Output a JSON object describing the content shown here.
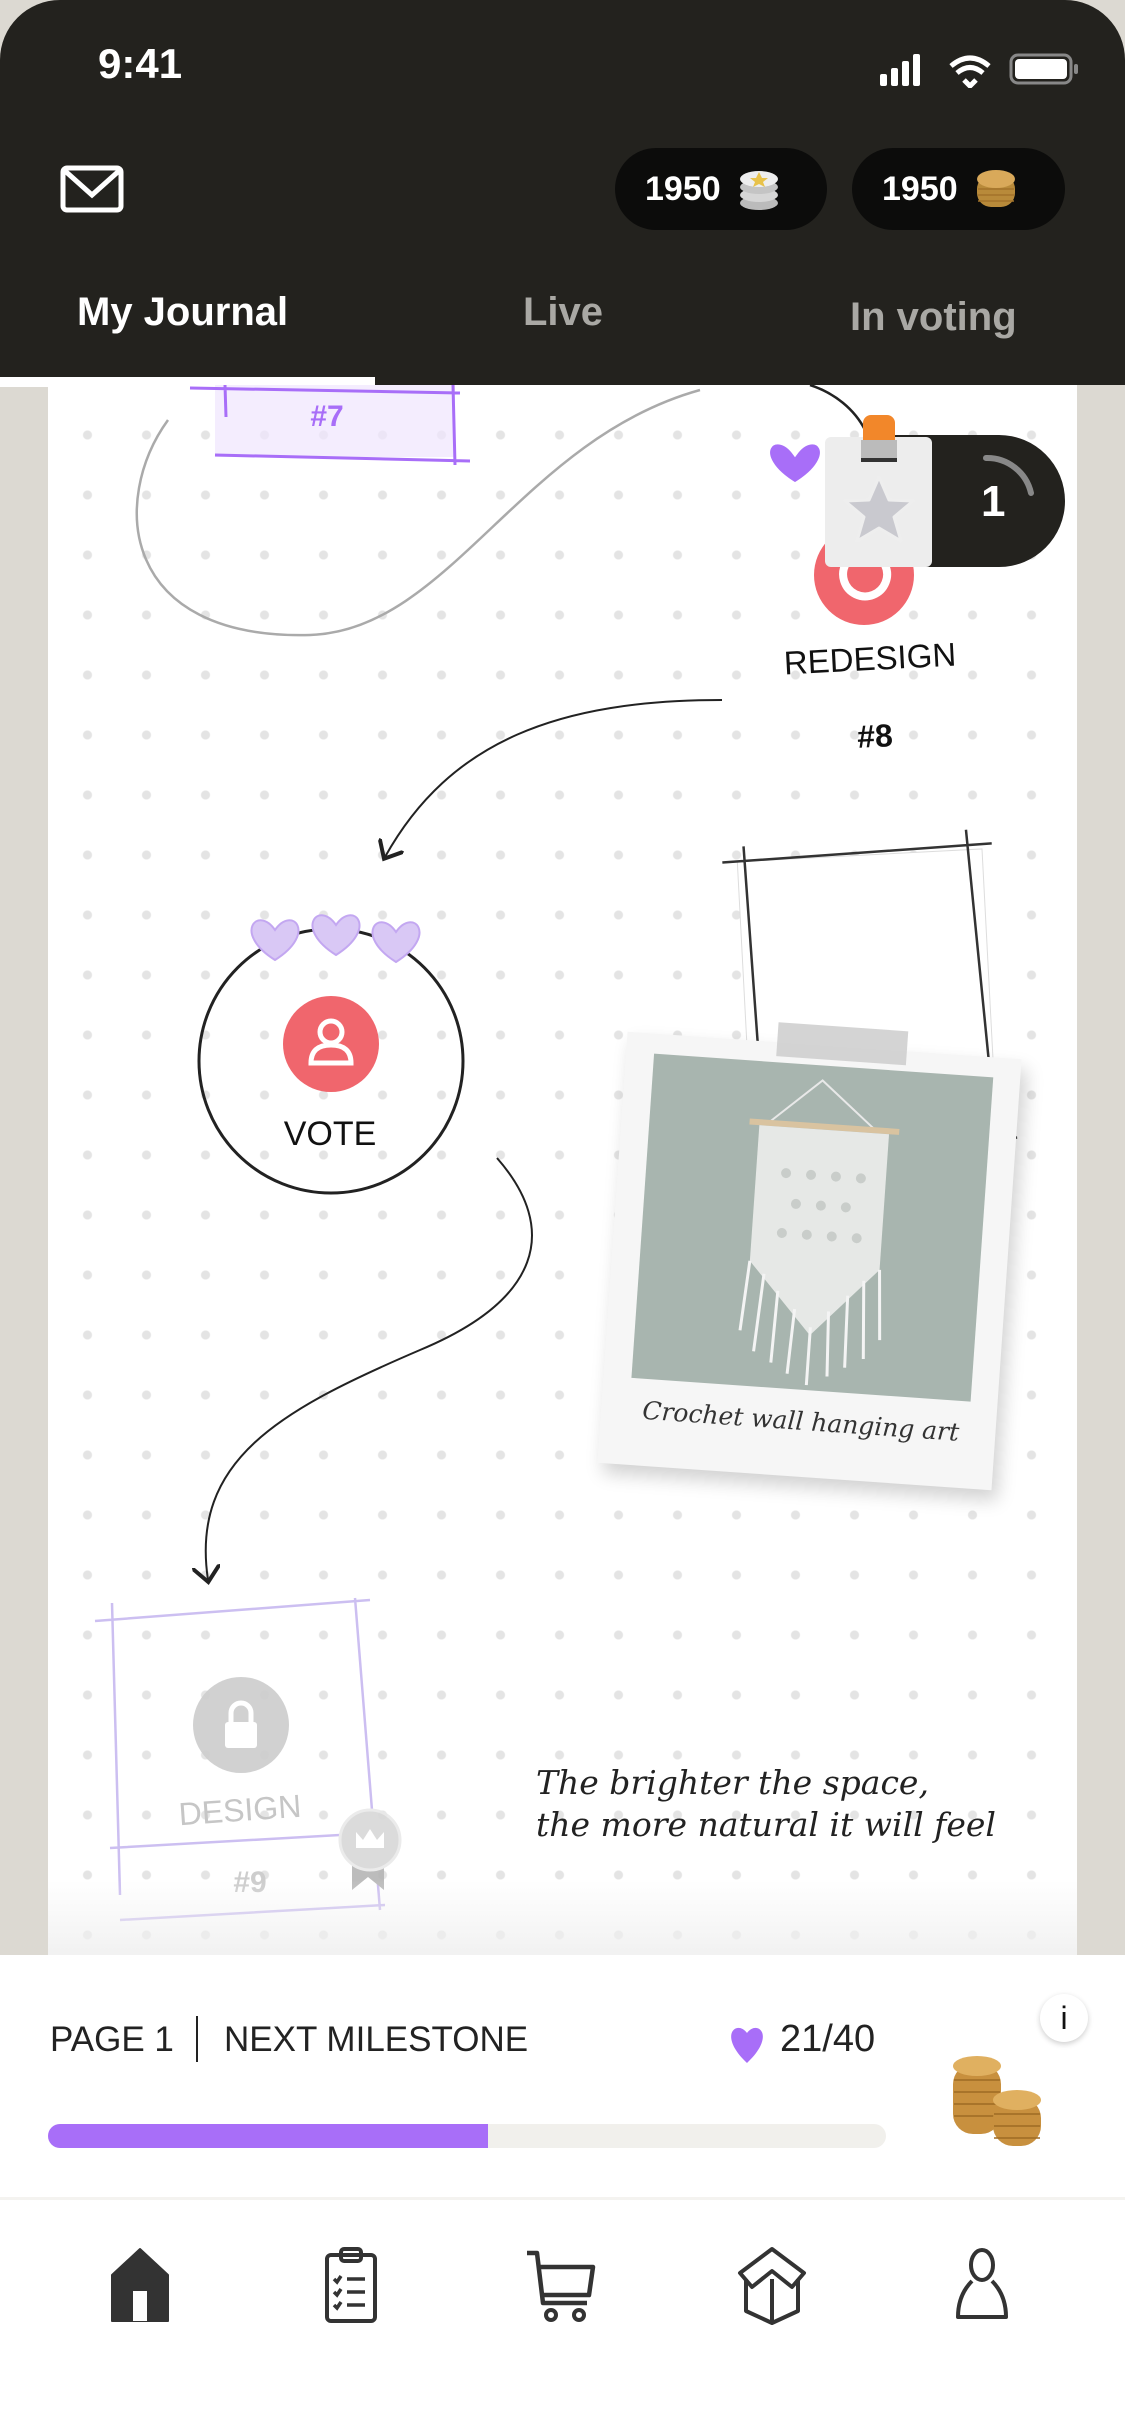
{
  "status_bar": {
    "time": "9:41",
    "icons": [
      "signal-icon",
      "wifi-icon",
      "battery-icon"
    ]
  },
  "header": {
    "mail_icon": "envelope-icon",
    "currencies": [
      {
        "amount": "1950",
        "icon": "silver-coins-icon"
      },
      {
        "amount": "1950",
        "icon": "gold-coins-icon"
      }
    ],
    "tabs": [
      {
        "label": "My Journal",
        "active": true
      },
      {
        "label": "Live",
        "active": false
      },
      {
        "label": "In voting",
        "active": false
      }
    ]
  },
  "journal": {
    "card7": {
      "number": "#7"
    },
    "card8": {
      "label": "REDESIGN",
      "number": "#8",
      "icon": "refresh-icon"
    },
    "badge": {
      "icon": "star-badge-icon",
      "count": "1"
    },
    "vote": {
      "label": "VOTE",
      "hearts": 3,
      "icon": "user-icon"
    },
    "polaroid": {
      "caption": "Crochet wall hanging art"
    },
    "card9": {
      "label": "DESIGN",
      "number": "#9",
      "icon": "lock-icon",
      "ribbon_icon": "crown-ribbon-icon"
    },
    "quote": {
      "line1": "The brighter the space,",
      "line2": "the more natural it will feel"
    }
  },
  "progress": {
    "page_label": "PAGE 1",
    "milestone_label": "NEXT MILESTONE",
    "count": "21/40",
    "value": 21,
    "max": 40,
    "fill_color": "#a86ef8",
    "info_label": "i"
  },
  "nav": [
    {
      "name": "home",
      "active": true
    },
    {
      "name": "tasks"
    },
    {
      "name": "shop"
    },
    {
      "name": "box"
    },
    {
      "name": "profile"
    }
  ],
  "colors": {
    "header": "#23221e",
    "accent": "#a86ef8",
    "red": "#f0666d"
  }
}
